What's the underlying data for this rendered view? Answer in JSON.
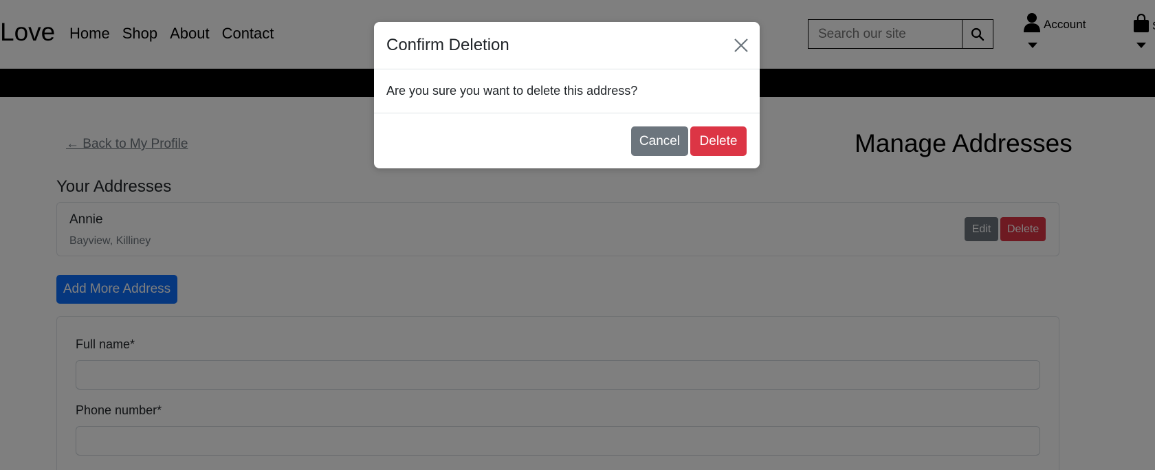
{
  "header": {
    "brand": "Love",
    "nav": [
      "Home",
      "Shop",
      "About",
      "Contact"
    ],
    "search_placeholder": "Search our site",
    "account_label": "Account",
    "cart_label": "S"
  },
  "main": {
    "back_link": "← Back to My Profile",
    "page_title": "Manage Addresses",
    "section_title": "Your Addresses",
    "address": {
      "name": "Annie",
      "line": "Bayview, Killiney",
      "edit_label": "Edit",
      "delete_label": "Delete"
    },
    "add_button": "Add More Address",
    "form": {
      "full_name_label": "Full name*",
      "phone_label": "Phone number*"
    }
  },
  "modal": {
    "title": "Confirm Deletion",
    "message": "Are you sure you want to delete this address?",
    "cancel_label": "Cancel",
    "delete_label": "Delete"
  },
  "colors": {
    "primary": "#0d6efd",
    "danger": "#dc3545",
    "secondary": "#6c757d",
    "backdrop": "rgba(0,0,0,0.5)"
  }
}
